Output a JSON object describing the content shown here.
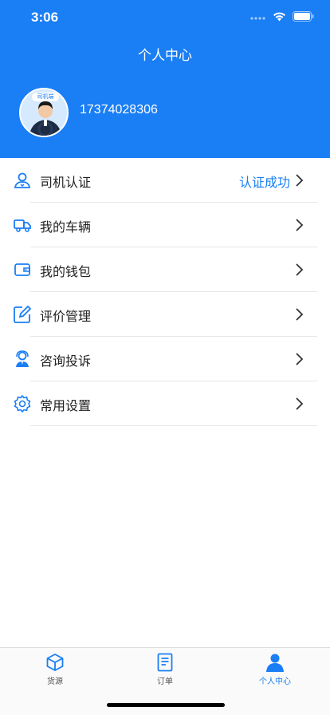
{
  "status_bar": {
    "time": "3:06"
  },
  "header": {
    "title": "个人中心",
    "avatar_badge": "司机端",
    "phone": "17374028306"
  },
  "menu": [
    {
      "label": "司机认证",
      "value": "认证成功",
      "icon": "driver-id-icon"
    },
    {
      "label": "我的车辆",
      "value": "",
      "icon": "truck-icon"
    },
    {
      "label": "我的钱包",
      "value": "",
      "icon": "wallet-icon"
    },
    {
      "label": "评价管理",
      "value": "",
      "icon": "edit-icon"
    },
    {
      "label": "咨询投诉",
      "value": "",
      "icon": "support-agent-icon"
    },
    {
      "label": "常用设置",
      "value": "",
      "icon": "gear-icon"
    }
  ],
  "tabbar": [
    {
      "label": "货源",
      "icon": "box-icon",
      "active": false
    },
    {
      "label": "订单",
      "icon": "document-icon",
      "active": false
    },
    {
      "label": "个人中心",
      "icon": "person-icon",
      "active": true
    }
  ],
  "colors": {
    "primary": "#1a7ef5"
  }
}
